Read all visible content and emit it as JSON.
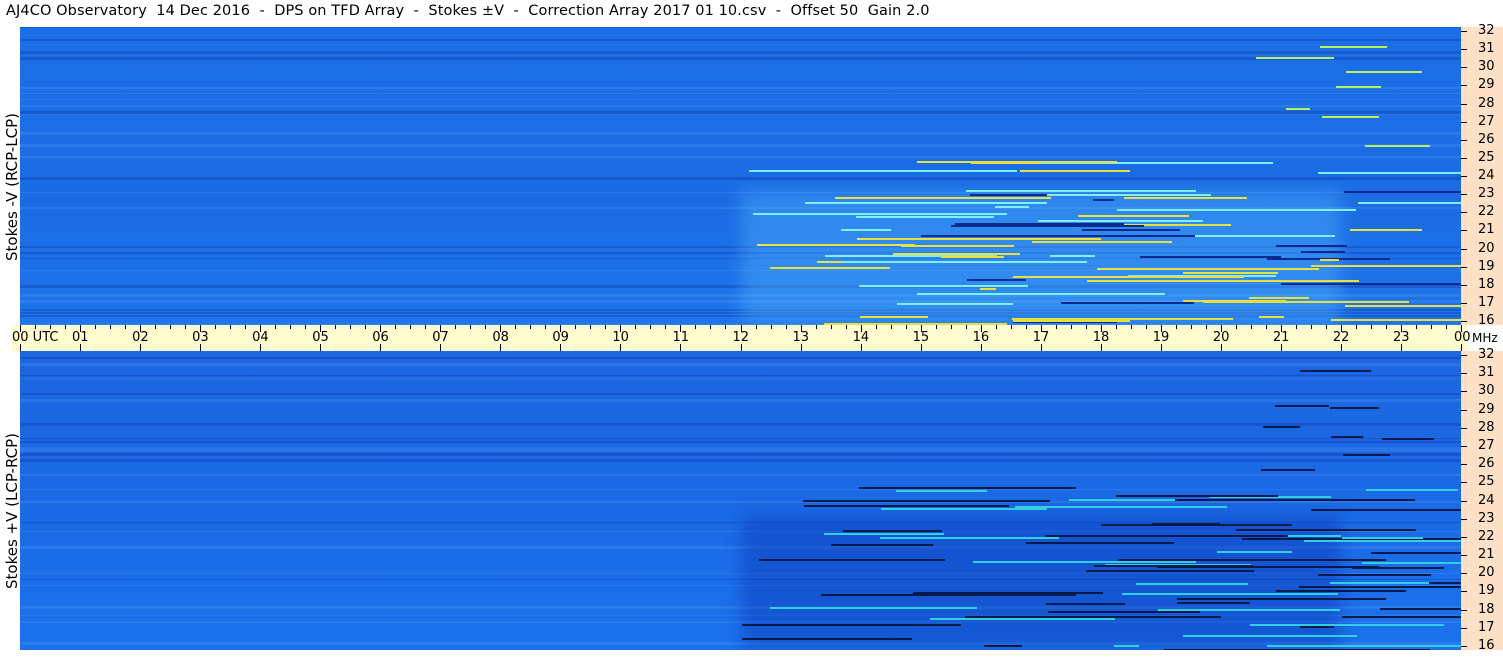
{
  "title": "AJ4CO Observatory  14 Dec 2016  -  DPS on TFD Array  -  Stokes ±V  -  Correction Array 2017 01 10.csv  -  Offset 50  Gain 2.0",
  "colors": {
    "background": "#1a6fe6",
    "low": "#102c9a",
    "high": "#f0e030",
    "timebar": "#fffdd0",
    "freq_axis": "#fde0c5"
  },
  "chart_data": [
    {
      "type": "heatmap",
      "ylabel": "Stokes -V (RCP-LCP)",
      "y_unit": "MHz",
      "ylim": [
        16,
        32
      ],
      "y_ticks": [
        16,
        17,
        18,
        19,
        20,
        21,
        22,
        23,
        24,
        25,
        26,
        27,
        28,
        29,
        30,
        31,
        32
      ],
      "x_unit": "UTC",
      "xlim": [
        "00",
        "00"
      ],
      "notes": "Broadband enhancement roughly 12-22 UTC at 16-22 MHz with bright narrowband streaks"
    },
    {
      "type": "heatmap",
      "ylabel": "Stokes +V (LCP-RCP)",
      "y_unit": "MHz",
      "ylim": [
        16,
        32
      ],
      "y_ticks": [
        16,
        17,
        18,
        19,
        20,
        21,
        22,
        23,
        24,
        25,
        26,
        27,
        28,
        29,
        30,
        31,
        32
      ],
      "x_unit": "UTC",
      "xlim": [
        "00",
        "00"
      ]
    }
  ],
  "time_axis": {
    "labels": [
      "00 UTC",
      "01",
      "02",
      "03",
      "04",
      "05",
      "06",
      "07",
      "08",
      "09",
      "10",
      "11",
      "12",
      "13",
      "14",
      "15",
      "16",
      "17",
      "18",
      "19",
      "20",
      "21",
      "22",
      "23",
      "00"
    ],
    "unit": "MHz"
  },
  "freq_axis": {
    "labels": [
      "32",
      "31",
      "30",
      "29",
      "28",
      "27",
      "26",
      "25",
      "24",
      "23",
      "22",
      "21",
      "20",
      "19",
      "18",
      "17",
      "16"
    ]
  }
}
